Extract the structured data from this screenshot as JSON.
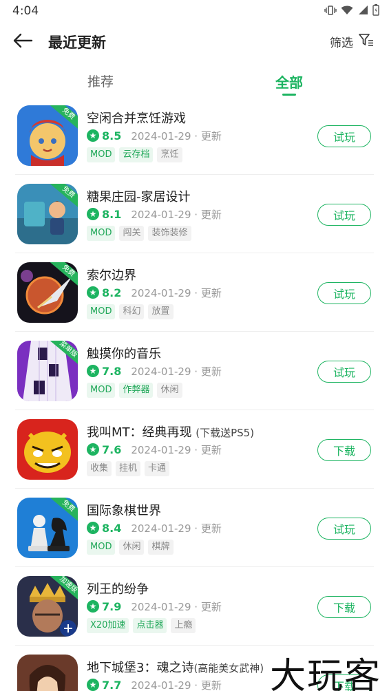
{
  "status_bar": {
    "time": "4:04"
  },
  "header": {
    "title": "最近更新",
    "filter_label": "筛选"
  },
  "tabs": [
    {
      "label": "推荐",
      "active": false
    },
    {
      "label": "全部",
      "active": true
    }
  ],
  "apps": [
    {
      "name": "空闲合并烹饪游戏",
      "suffix": "",
      "badge": "免费",
      "score": "8.5",
      "date": "2024-01-29 · 更新",
      "tags": [
        {
          "text": "MOD",
          "style": "green"
        },
        {
          "text": "云存档",
          "style": "green"
        },
        {
          "text": "烹饪",
          "style": "gray"
        }
      ],
      "action": "试玩"
    },
    {
      "name": "糖果庄园-家居设计",
      "suffix": "",
      "badge": "免费",
      "score": "8.1",
      "date": "2024-01-29 · 更新",
      "tags": [
        {
          "text": "MOD",
          "style": "green"
        },
        {
          "text": "闯关",
          "style": "gray"
        },
        {
          "text": "装饰装修",
          "style": "gray"
        }
      ],
      "action": "试玩"
    },
    {
      "name": "索尔边界",
      "suffix": "",
      "badge": "免费",
      "score": "8.2",
      "date": "2024-01-29 · 更新",
      "tags": [
        {
          "text": "MOD",
          "style": "green"
        },
        {
          "text": "科幻",
          "style": "gray"
        },
        {
          "text": "放置",
          "style": "gray"
        }
      ],
      "action": "试玩"
    },
    {
      "name": "触摸你的音乐",
      "suffix": "",
      "badge": "菜单版",
      "score": "7.8",
      "date": "2024-01-29 · 更新",
      "tags": [
        {
          "text": "MOD",
          "style": "green"
        },
        {
          "text": "作弊器",
          "style": "green"
        },
        {
          "text": "休闲",
          "style": "gray"
        }
      ],
      "action": "试玩"
    },
    {
      "name": "我叫MT：经典再现",
      "suffix": "(下载送PS5)",
      "badge": "",
      "score": "7.6",
      "date": "2024-01-29 · 更新",
      "tags": [
        {
          "text": "收集",
          "style": "gray"
        },
        {
          "text": "挂机",
          "style": "gray"
        },
        {
          "text": "卡通",
          "style": "gray"
        }
      ],
      "action": "下载"
    },
    {
      "name": "国际象棋世界",
      "suffix": "",
      "badge": "免费",
      "score": "8.4",
      "date": "2024-01-29 · 更新",
      "tags": [
        {
          "text": "MOD",
          "style": "green"
        },
        {
          "text": "休闲",
          "style": "gray"
        },
        {
          "text": "棋牌",
          "style": "gray"
        }
      ],
      "action": "试玩"
    },
    {
      "name": "列王的纷争",
      "suffix": "",
      "badge": "加速版",
      "score": "7.9",
      "date": "2024-01-29 · 更新",
      "tags": [
        {
          "text": "X20加速",
          "style": "green"
        },
        {
          "text": "点击器",
          "style": "green"
        },
        {
          "text": "上瘾",
          "style": "gray"
        }
      ],
      "action": "下载"
    },
    {
      "name": "地下城堡3：魂之诗",
      "suffix": "(高能美女武神)",
      "badge": "",
      "score": "7.7",
      "date": "2024-01-29 · 更新",
      "tags": [],
      "action": "下载"
    }
  ],
  "watermark": "大玩客",
  "colors": {
    "accent": "#1db461",
    "tag_green_bg": "#eaf7ef",
    "tag_gray_bg": "#f2f2f2"
  }
}
